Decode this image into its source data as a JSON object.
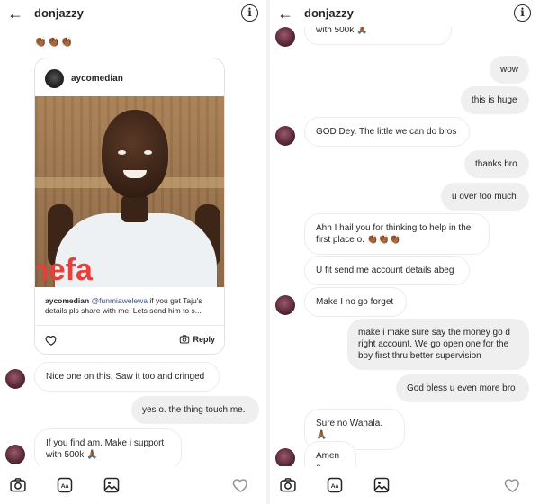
{
  "left": {
    "header": {
      "title": "donjazzy"
    },
    "top_emoji": "👏🏾👏🏾👏🏾",
    "post": {
      "username": "aycomedian",
      "watermark": "nefa",
      "caption_user": "aycomedian",
      "caption_mention": "@funmiawelewa",
      "caption_text": "if you get Taju's details pls share with me. Lets send him to s...",
      "reply_label": "Reply"
    },
    "messages": [
      {
        "direction": "in",
        "text": "Nice one on this. Saw it too and cringed",
        "avatar": true
      },
      {
        "direction": "out",
        "text": "yes o. the thing touch me."
      },
      {
        "direction": "in",
        "text": "If you find am. Make i support with 500k 🙏🏾",
        "avatar": true
      }
    ]
  },
  "right": {
    "header": {
      "title": "donjazzy"
    },
    "messages": [
      {
        "direction": "in",
        "text": "with 500k 🙏🏾",
        "avatar": true
      },
      {
        "direction": "out",
        "text": "wow"
      },
      {
        "direction": "out",
        "text": "this is huge"
      },
      {
        "direction": "in",
        "text": "GOD Dey. The little we can do bros",
        "avatar": true
      },
      {
        "direction": "out",
        "text": "thanks bro"
      },
      {
        "direction": "out",
        "text": "u over too much"
      },
      {
        "direction": "in",
        "text": "Ahh I hail you for thinking to help in the first place o. 👏🏾👏🏾👏🏾",
        "avatar": false
      },
      {
        "direction": "in",
        "text": "U fit send me account details abeg",
        "avatar": false
      },
      {
        "direction": "in",
        "text": "Make I no go forget",
        "avatar": true
      },
      {
        "direction": "out",
        "text": "make i make sure say the money go d right account. We go open one for the boy first thru better supervision"
      },
      {
        "direction": "out",
        "text": "God bless u even more bro"
      },
      {
        "direction": "in",
        "text": "Sure no Wahala. 🙏🏾",
        "avatar": false
      },
      {
        "direction": "in",
        "text": "Amen o",
        "avatar": true
      }
    ]
  },
  "composer": {
    "icons": [
      "camera-icon",
      "sticker-icon",
      "gallery-icon",
      "heart-icon"
    ]
  },
  "colors": {
    "incoming_bubble": "#ffffff",
    "outgoing_bubble": "#efefef",
    "mention": "#385185",
    "watermark": "#e4413b"
  }
}
